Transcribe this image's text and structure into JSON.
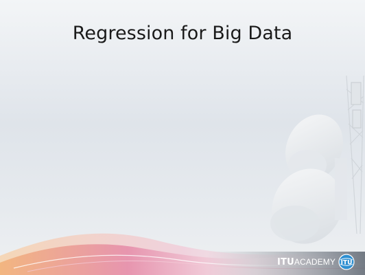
{
  "slide": {
    "title": "Regression for Big Data"
  },
  "logo": {
    "part1": "ITU",
    "part2": "ACADEMY",
    "emblem_text": "ITU"
  },
  "colors": {
    "title_text": "#1a1a1a",
    "logo_bg": "#2b3643",
    "wave_pink": "#e58aa8",
    "wave_orange": "#f2b27a"
  },
  "icons": {
    "emblem": "itu-emblem-icon",
    "background": "satellite-dish-icon"
  }
}
